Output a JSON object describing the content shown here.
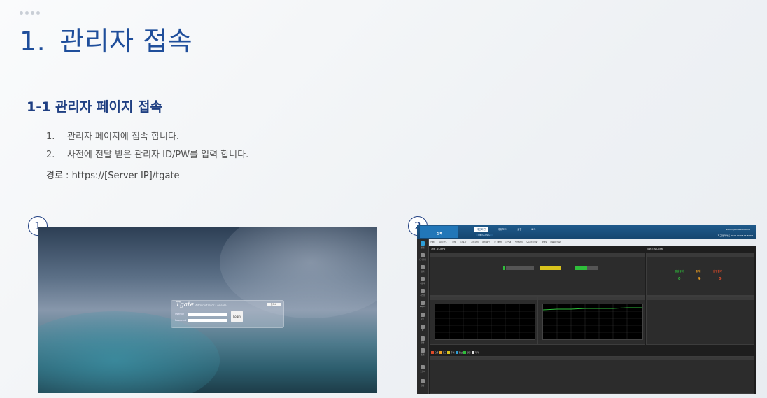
{
  "page": {
    "title_num": "1.",
    "title_text": "관리자 접속",
    "subtitle": "1-1 관리자 페이지 접속",
    "steps": [
      {
        "num": "1.",
        "text": "관리자 페이지에 접속 합니다."
      },
      {
        "num": "2.",
        "text": "사전에 전달 받은 관리자 ID/PW를 입력 합니다."
      }
    ],
    "path": "경로 : https://[Server IP]/tgate"
  },
  "badges": {
    "one": "1",
    "two": "2"
  },
  "login": {
    "brand": "Tgate",
    "brand_sub": "Administrator Console",
    "lang": "한국어",
    "user_label": "User ID",
    "pass_label": "Password",
    "button": "Login"
  },
  "dashboard": {
    "home_label": "전체",
    "tabs": [
      "메인화면",
      "대쉬보드",
      "설정",
      "로그"
    ],
    "crumb": "전체 대시보드",
    "user": "admin (Administrators)",
    "status": "최근 업데이트 2021-09-06 17:30:58",
    "subtabs": [
      "전체",
      "대쉬보드",
      "정책",
      "사용자",
      "계정관리",
      "네트워크",
      "로그분석",
      "시스템",
      "백업관리",
      "모니터링현황",
      "PMS",
      "사용자 현황"
    ],
    "sidebar": [
      "전체",
      "모니터링",
      "정책",
      "사용자",
      "시스템",
      "Report",
      "로그",
      "IP",
      "현황",
      "통계",
      "보고서",
      "설정"
    ],
    "server_monitor": "서버 모니터링",
    "resource_monitor": "리소스 모니터링",
    "counts": [
      {
        "label": "정상동작",
        "value": "0"
      },
      {
        "label": "중지",
        "value": "4"
      },
      {
        "label": "운영불가",
        "value": "0"
      }
    ],
    "legend": [
      "오류",
      "경고",
      "주의",
      "정보",
      "알림",
      "기타"
    ],
    "accent": "#1f5b8c"
  },
  "colors": {
    "title": "#1f4e9b",
    "subtitle": "#1f3f82"
  }
}
